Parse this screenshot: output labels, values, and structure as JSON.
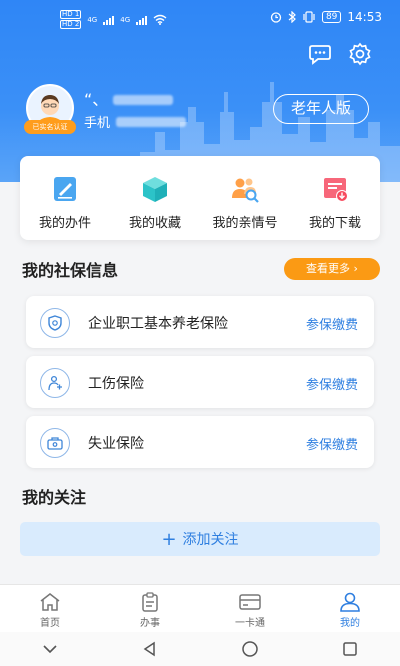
{
  "status_bar": {
    "sim1": "HD 1",
    "sim2": "HD 2",
    "net1": "4G",
    "net2": "4G",
    "battery": "89",
    "time": "14:53"
  },
  "profile": {
    "auth_badge": "已实名认证",
    "name_prefix": "“、",
    "phone_prefix": "手机",
    "elder_mode_label": "老年人版"
  },
  "quick_actions": [
    {
      "label": "我的办件",
      "icon": "document-edit-icon"
    },
    {
      "label": "我的收藏",
      "icon": "box-icon"
    },
    {
      "label": "我的亲情号",
      "icon": "family-icon"
    },
    {
      "label": "我的下载",
      "icon": "download-icon"
    }
  ],
  "social_security": {
    "title": "我的社保信息",
    "more_label": "查看更多",
    "items": [
      {
        "label": "企业职工基本养老保险",
        "action": "参保缴费",
        "icon": "pension-icon"
      },
      {
        "label": "工伤保险",
        "action": "参保缴费",
        "icon": "injury-icon"
      },
      {
        "label": "失业保险",
        "action": "参保缴费",
        "icon": "unemployment-icon"
      }
    ]
  },
  "follow": {
    "title": "我的关注",
    "add_label": "添加关注"
  },
  "tabbar": [
    {
      "label": "首页",
      "icon": "home-icon",
      "active": false
    },
    {
      "label": "办事",
      "icon": "clipboard-icon",
      "active": false
    },
    {
      "label": "一卡通",
      "icon": "card-icon",
      "active": false
    },
    {
      "label": "我的",
      "icon": "person-icon",
      "active": true
    }
  ],
  "colors": {
    "header_blue": "#2f86f6",
    "accent_blue": "#2f7fe0",
    "orange": "#fb9a14"
  }
}
